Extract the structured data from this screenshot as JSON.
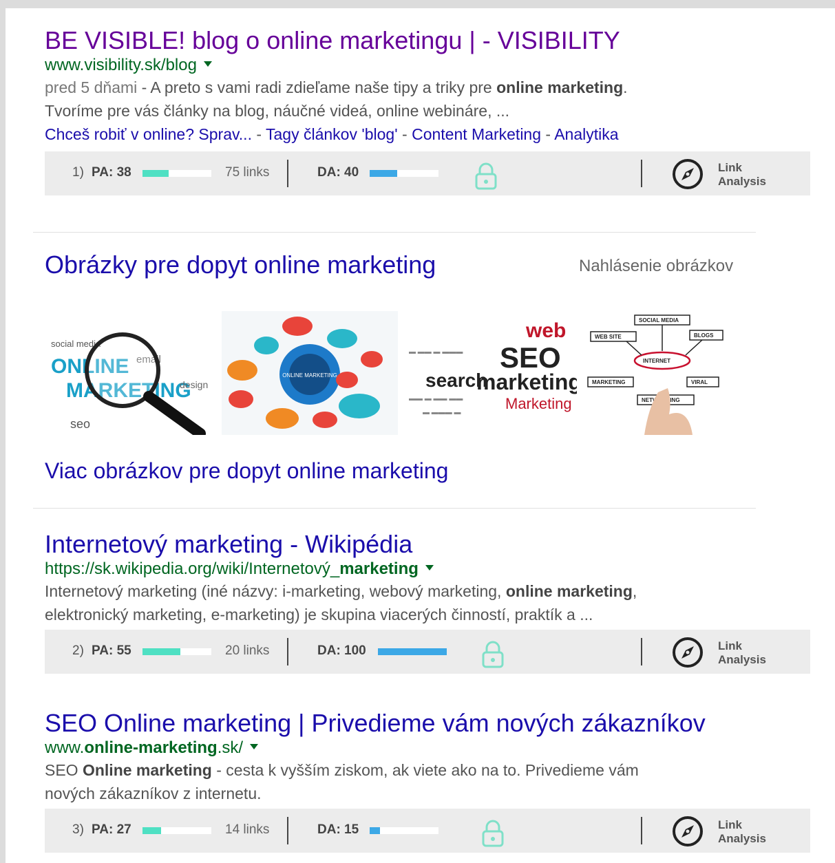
{
  "results": [
    {
      "title": "BE VISIBLE! blog o online marketingu | - VISIBILITY",
      "url": "www.visibility.sk/blog",
      "snippet_date": "pred 5 dňami",
      "snippet_a": " - A preto s vami radi zdieľame naše tipy a triky pre ",
      "snippet_bold": "online marketing",
      "snippet_b": ".",
      "snippet_line2": "Tvoríme pre vás články na blog, náučné videá, online webináre, ...",
      "sitelinks": [
        "Chceš robiť v online? Sprav...",
        "Tagy článkov 'blog'",
        "Content Marketing",
        "Analytika"
      ],
      "sitelink_sep": " - "
    },
    {
      "title": "Internetový marketing - Wikipédia",
      "url_plain": "https://sk.wikipedia.org/wiki/Internetový_",
      "url_bold": "marketing",
      "snippet_a": "Internetový marketing (iné názvy: i-marketing, webový marketing, ",
      "snippet_bold": "online marketing",
      "snippet_b": ",",
      "snippet_line2": "elektronický marketing, e-marketing) je skupina viacerých činností, praktík a ..."
    },
    {
      "title": "SEO Online marketing | Privedieme vám nových zákazníkov",
      "url_a": "www.",
      "url_bold": "online-marketing",
      "url_b": ".sk/",
      "snippet_a": "SEO ",
      "snippet_bold": "Online marketing",
      "snippet_b": " - cesta k vyšším ziskom, ak viete ako na to. Privedieme vám",
      "snippet_line2": "nových zákazníkov z internetu."
    }
  ],
  "moz": [
    {
      "rank": "1)",
      "pa": "PA: 38",
      "pa_value": 38,
      "links": "75 links",
      "da": "DA: 40",
      "da_value": 40
    },
    {
      "rank": "2)",
      "pa": "PA: 55",
      "pa_value": 55,
      "links": "20 links",
      "da": "DA: 100",
      "da_value": 100
    },
    {
      "rank": "3)",
      "pa": "PA: 27",
      "pa_value": 27,
      "links": "14 links",
      "da": "DA: 15",
      "da_value": 15
    }
  ],
  "moz_link_analysis": [
    "Link",
    "Analysis"
  ],
  "images": {
    "heading": "Obrázky pre dopyt online marketing",
    "report": "Nahlásenie obrázkov",
    "more": "Viac obrázkov pre dopyt online marketing",
    "thumb1_words": [
      "ONLINE",
      "MARKETING",
      "social media",
      "seo",
      "email",
      "design"
    ],
    "thumb2_center": "ONLINE MARKETING",
    "thumb3_words": [
      "web",
      "SEO",
      "search",
      "marketing",
      "Marketing"
    ],
    "thumb4_words": [
      "SOCIAL MEDIA",
      "WEB SITE",
      "BLOGS",
      "INTERNET",
      "MARKETING",
      "VIRAL",
      "NETWORKING"
    ]
  },
  "colors": {
    "pa_bar": "#4fe0c3",
    "da_bar": "#3ca8e6",
    "link": "#1a0dab",
    "visited": "#660099",
    "url": "#006621",
    "lock": "#7fe0c8"
  }
}
